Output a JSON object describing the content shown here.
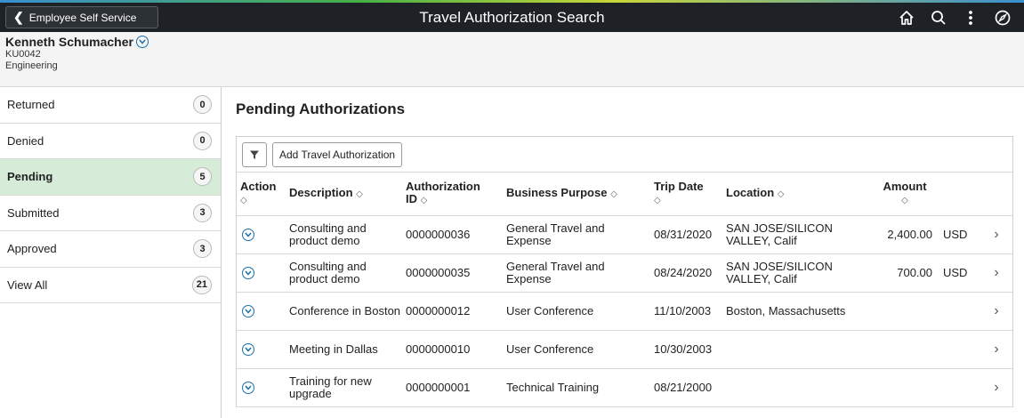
{
  "topbar": {
    "back_label": "Employee Self Service",
    "title": "Travel Authorization Search",
    "icons": [
      "home-icon",
      "search-icon",
      "more-vert-icon",
      "navbar-compass-icon"
    ]
  },
  "employee": {
    "name": "Kenneth Schumacher",
    "id": "KU0042",
    "department": "Engineering"
  },
  "sidebar": {
    "items": [
      {
        "label": "Returned",
        "count": "0"
      },
      {
        "label": "Denied",
        "count": "0"
      },
      {
        "label": "Pending",
        "count": "5"
      },
      {
        "label": "Submitted",
        "count": "3"
      },
      {
        "label": "Approved",
        "count": "3"
      },
      {
        "label": "View All",
        "count": "21"
      }
    ],
    "active": "Pending"
  },
  "main": {
    "section_title": "Pending Authorizations",
    "add_button": "Add Travel Authorization",
    "columns": {
      "action": "Action",
      "description": "Description",
      "auth_id_1": "Authorization",
      "auth_id_2": "ID",
      "business_purpose": "Business Purpose",
      "trip_date": "Trip Date",
      "location": "Location",
      "amount": "Amount"
    },
    "sort_glyph": "◇",
    "rows": [
      {
        "description": "Consulting and product demo",
        "auth_id": "0000000036",
        "purpose": "General Travel and Expense",
        "trip_date": "08/31/2020",
        "location": "SAN JOSE/SILICON VALLEY, Calif",
        "amount": "2,400.00",
        "currency": "USD"
      },
      {
        "description": "Consulting and product demo",
        "auth_id": "0000000035",
        "purpose": "General Travel and Expense",
        "trip_date": "08/24/2020",
        "location": "SAN JOSE/SILICON VALLEY, Calif",
        "amount": "700.00",
        "currency": "USD"
      },
      {
        "description": "Conference in Boston",
        "auth_id": "0000000012",
        "purpose": "User Conference",
        "trip_date": "11/10/2003",
        "location": "Boston, Massachusetts",
        "amount": "",
        "currency": ""
      },
      {
        "description": "Meeting in Dallas",
        "auth_id": "0000000010",
        "purpose": "User Conference",
        "trip_date": "10/30/2003",
        "location": "",
        "amount": "",
        "currency": ""
      },
      {
        "description": "Training for new upgrade",
        "auth_id": "0000000001",
        "purpose": "Technical Training",
        "trip_date": "08/21/2000",
        "location": "",
        "amount": "",
        "currency": ""
      }
    ]
  },
  "colors": {
    "topbar_bg": "#1e2226",
    "active_item_bg": "#d6ecd9",
    "accent": "#1a6fa8"
  }
}
